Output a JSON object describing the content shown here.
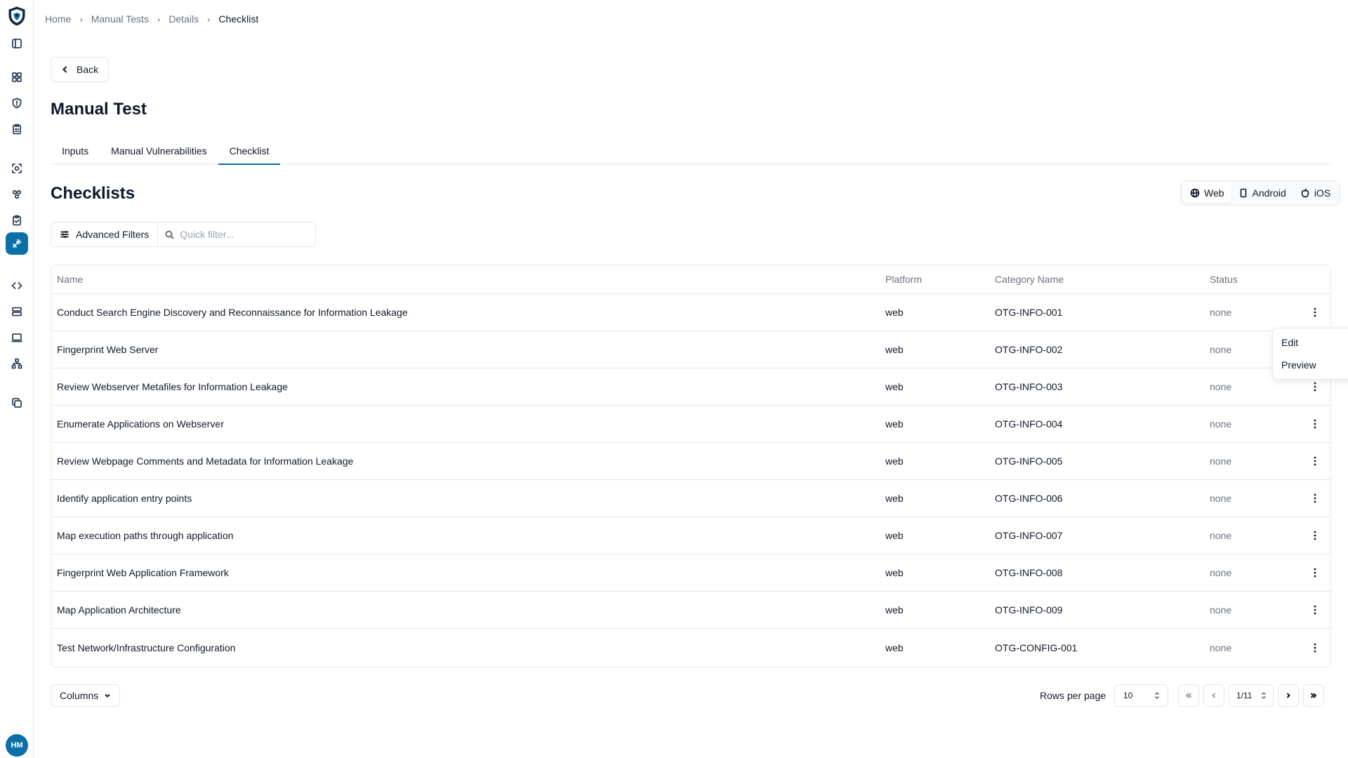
{
  "sidebar": {
    "logo": "shield-logo",
    "avatar_initials": "HM",
    "accent": "#0b6fa8"
  },
  "breadcrumb": [
    "Home",
    "Manual Tests",
    "Details",
    "Checklist"
  ],
  "back_label": "Back",
  "page_title": "Manual Test",
  "tabs": [
    {
      "label": "Inputs",
      "active": false
    },
    {
      "label": "Manual Vulnerabilities",
      "active": false
    },
    {
      "label": "Checklist",
      "active": true
    }
  ],
  "section_title": "Checklists",
  "platform_toggle": [
    {
      "label": "Web",
      "icon": "globe-icon",
      "active": true
    },
    {
      "label": "Android",
      "icon": "phone-icon",
      "active": false
    },
    {
      "label": "iOS",
      "icon": "apple-icon",
      "active": false
    }
  ],
  "filters": {
    "advanced_label": "Advanced Filters",
    "quick_placeholder": "Quick filter..."
  },
  "table": {
    "headers": {
      "name": "Name",
      "platform": "Platform",
      "category": "Category Name",
      "status": "Status"
    },
    "rows": [
      {
        "name": "Conduct Search Engine Discovery and Reconnaissance for Information Leakage",
        "platform": "web",
        "category": "OTG-INFO-001",
        "status": "none"
      },
      {
        "name": "Fingerprint Web Server",
        "platform": "web",
        "category": "OTG-INFO-002",
        "status": "none"
      },
      {
        "name": "Review Webserver Metafiles for Information Leakage",
        "platform": "web",
        "category": "OTG-INFO-003",
        "status": "none"
      },
      {
        "name": "Enumerate Applications on Webserver",
        "platform": "web",
        "category": "OTG-INFO-004",
        "status": "none"
      },
      {
        "name": "Review Webpage Comments and Metadata for Information Leakage",
        "platform": "web",
        "category": "OTG-INFO-005",
        "status": "none"
      },
      {
        "name": "Identify application entry points",
        "platform": "web",
        "category": "OTG-INFO-006",
        "status": "none"
      },
      {
        "name": "Map execution paths through application",
        "platform": "web",
        "category": "OTG-INFO-007",
        "status": "none"
      },
      {
        "name": "Fingerprint Web Application Framework",
        "platform": "web",
        "category": "OTG-INFO-008",
        "status": "none"
      },
      {
        "name": "Map Application Architecture",
        "platform": "web",
        "category": "OTG-INFO-009",
        "status": "none"
      },
      {
        "name": "Test Network/Infrastructure Configuration",
        "platform": "web",
        "category": "OTG-CONFIG-001",
        "status": "none"
      }
    ]
  },
  "row_menu": {
    "edit": "Edit",
    "preview": "Preview"
  },
  "footer": {
    "columns_label": "Columns",
    "rows_per_page_label": "Rows per page",
    "rows_per_page_value": "10",
    "page_value": "1/11"
  }
}
